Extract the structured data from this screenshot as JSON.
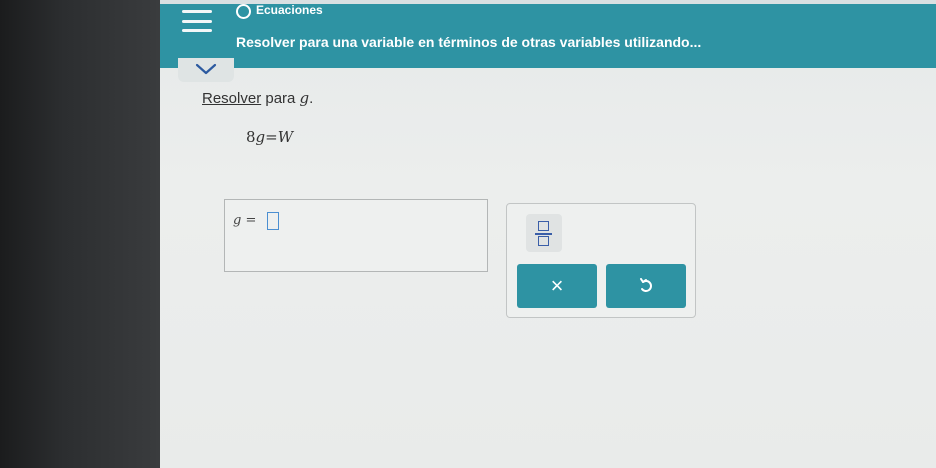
{
  "header": {
    "section_title": "Ecuaciones",
    "problem_title": "Resolver para una variable en términos de otras variables utilizando..."
  },
  "instruction": {
    "link_text": "Resolver",
    "text": " para ",
    "variable": "g",
    "period": "."
  },
  "equation": {
    "left": "8",
    "variable": "g",
    "equals": "=",
    "right": "W"
  },
  "answer": {
    "variable": "g",
    "equals": "=",
    "value": ""
  },
  "tools": {
    "clear_label": "×"
  },
  "colors": {
    "teal_brand": "#2e93a3",
    "input_border": "#4b8fd1"
  },
  "icons": [
    "menu-icon",
    "status-circle-icon",
    "chevron-down-icon",
    "fraction-icon",
    "undo-icon"
  ]
}
